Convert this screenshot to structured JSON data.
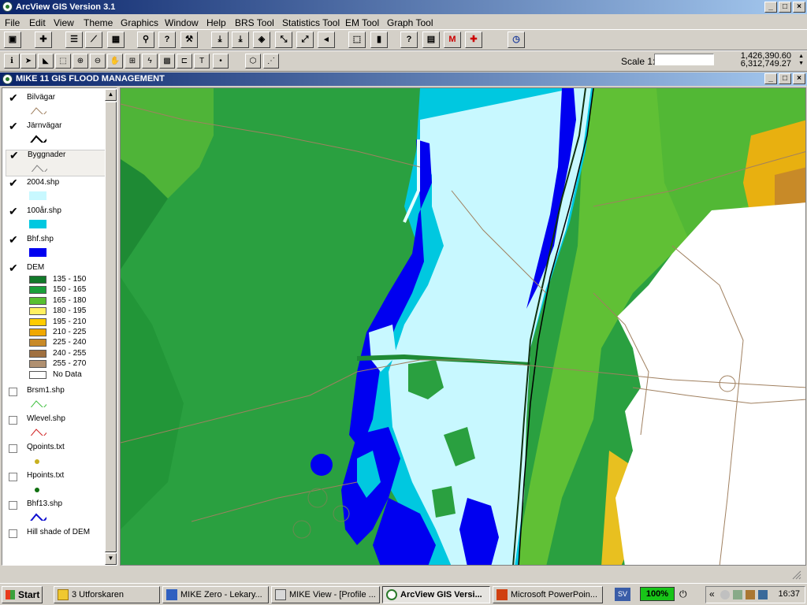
{
  "app": {
    "title": "ArcView GIS Version 3.1",
    "window_buttons": [
      "_",
      "□",
      "×"
    ]
  },
  "menu": [
    "File",
    "Edit",
    "View",
    "Theme",
    "Graphics",
    "Window",
    "Help",
    "BRS Tool",
    "Statistics Tool",
    "EM Tool",
    "Graph Tool"
  ],
  "toolbar2": {
    "scale_label": "Scale 1:",
    "scale_value": "",
    "coord_x": "1,426,390.60",
    "coord_y": "6,312,749.27"
  },
  "document": {
    "title": "MIKE 11 GIS FLOOD MANAGEMENT"
  },
  "toc": {
    "themes": [
      {
        "name": "Bilvägar",
        "checked": true,
        "legend": "line",
        "color": "#a08060"
      },
      {
        "name": "Järnvägar",
        "checked": true,
        "legend": "line",
        "color": "#000000"
      },
      {
        "name": "Byggnader",
        "checked": true,
        "legend": "line",
        "color": "#808080"
      },
      {
        "name": "2004.shp",
        "checked": true,
        "legend": "fill",
        "color": "#c8f8ff"
      },
      {
        "name": "100år.shp",
        "checked": true,
        "legend": "fill",
        "color": "#00c8e0"
      },
      {
        "name": "Bhf.shp",
        "checked": true,
        "legend": "fill",
        "color": "#0000f0"
      },
      {
        "name": "DEM",
        "checked": true,
        "legend": "classes"
      },
      {
        "name": "Brsm1.shp",
        "checked": false,
        "legend": "line",
        "color": "#40c040"
      },
      {
        "name": "Wlevel.shp",
        "checked": false,
        "legend": "line",
        "color": "#d02020"
      },
      {
        "name": "Qpoints.txt",
        "checked": false,
        "legend": "point",
        "color": "#c8b020"
      },
      {
        "name": "Hpoints.txt",
        "checked": false,
        "legend": "point",
        "color": "#107010"
      },
      {
        "name": "Bhf13.shp",
        "checked": false,
        "legend": "line",
        "color": "#1010d0"
      },
      {
        "name": "Hill shade of DEM",
        "checked": false,
        "legend": "none"
      }
    ],
    "dem_classes": [
      {
        "label": "135 - 150",
        "color": "#127a2a"
      },
      {
        "label": "150 - 165",
        "color": "#1aa03a"
      },
      {
        "label": "165 - 180",
        "color": "#58c030"
      },
      {
        "label": "180 - 195",
        "color": "#fff060"
      },
      {
        "label": "195 - 210",
        "color": "#ffcc00"
      },
      {
        "label": "210 - 225",
        "color": "#f0a800"
      },
      {
        "label": "225 - 240",
        "color": "#c88a28"
      },
      {
        "label": "240 - 255",
        "color": "#a07040"
      },
      {
        "label": "255 - 270",
        "color": "#b09070"
      },
      {
        "label": "No Data",
        "color": "#ffffff"
      }
    ]
  },
  "taskbar": {
    "start": "Start",
    "tasks": [
      {
        "label": "3 Utforskaren",
        "active": false
      },
      {
        "label": "MIKE Zero - Lekary...",
        "active": false
      },
      {
        "label": "MIKE View - [Profile ...",
        "active": false
      },
      {
        "label": "ArcView GIS Versi...",
        "active": true
      },
      {
        "label": "Microsoft PowerPoin...",
        "active": false
      }
    ],
    "lang": "SV",
    "battery": "100%",
    "clock": "16:37",
    "chevron": "«"
  }
}
